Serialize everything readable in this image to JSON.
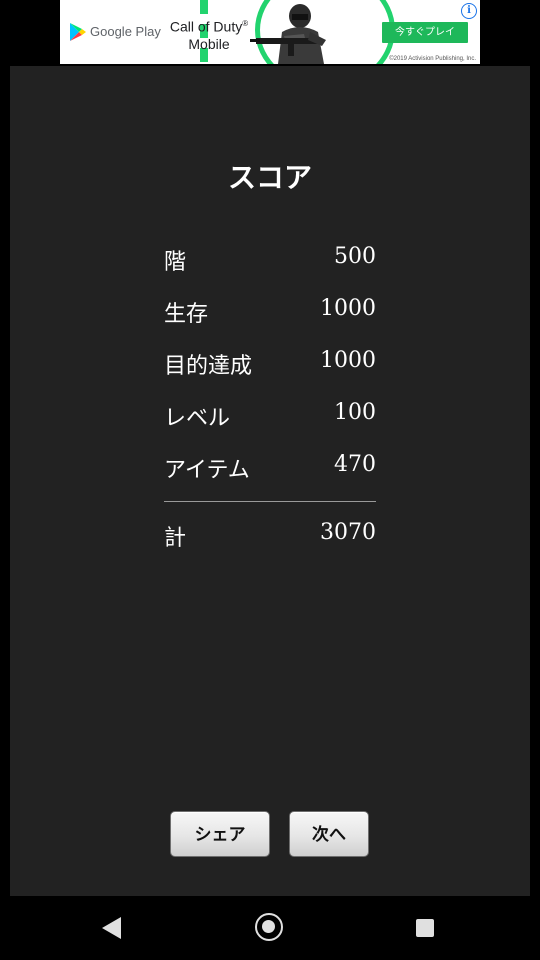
{
  "ad": {
    "store_label": "Google Play",
    "title": "Call of Duty",
    "title_mark": "®",
    "subtitle": "Mobile",
    "cta_label": "今すぐプレイ",
    "info_label": "i",
    "copyright": "©2019 Activision Publishing, Inc.",
    "accent_color": "#22d36e"
  },
  "score": {
    "title": "スコア",
    "rows": [
      {
        "label": "階",
        "value": "500"
      },
      {
        "label": "生存",
        "value": "1000"
      },
      {
        "label": "目的達成",
        "value": "1000"
      },
      {
        "label": "レベル",
        "value": "100"
      },
      {
        "label": "アイテム",
        "value": "470"
      }
    ],
    "total": {
      "label": "計",
      "value": "3070"
    }
  },
  "buttons": {
    "share_label": "シェア",
    "next_label": "次へ"
  },
  "nav": {
    "back_icon": "triangle-back-icon",
    "home_icon": "circle-home-icon",
    "recents_icon": "square-recents-icon"
  }
}
